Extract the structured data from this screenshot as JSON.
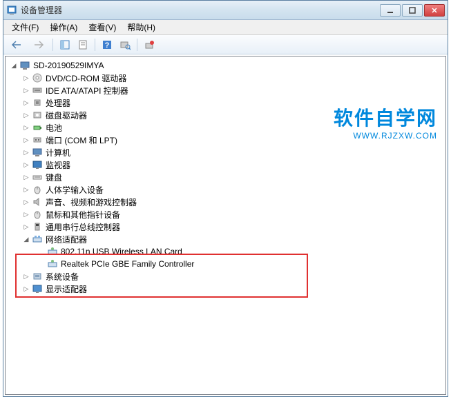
{
  "window": {
    "title": "设备管理器"
  },
  "menu": {
    "file": "文件(F)",
    "action": "操作(A)",
    "view": "查看(V)",
    "help": "帮助(H)"
  },
  "tree": {
    "root": "SD-20190529IMYA",
    "items": [
      {
        "label": "DVD/CD-ROM 驱动器",
        "icon": "disc"
      },
      {
        "label": "IDE ATA/ATAPI 控制器",
        "icon": "ide"
      },
      {
        "label": "处理器",
        "icon": "cpu"
      },
      {
        "label": "磁盘驱动器",
        "icon": "disk"
      },
      {
        "label": "电池",
        "icon": "battery"
      },
      {
        "label": "端口 (COM 和 LPT)",
        "icon": "port"
      },
      {
        "label": "计算机",
        "icon": "computer"
      },
      {
        "label": "监视器",
        "icon": "monitor"
      },
      {
        "label": "键盘",
        "icon": "keyboard"
      },
      {
        "label": "人体学输入设备",
        "icon": "hid"
      },
      {
        "label": "声音、视频和游戏控制器",
        "icon": "sound"
      },
      {
        "label": "鼠标和其他指针设备",
        "icon": "mouse"
      },
      {
        "label": "通用串行总线控制器",
        "icon": "usb"
      }
    ],
    "network": {
      "label": "网络适配器",
      "children": [
        "802.11n USB Wireless LAN Card",
        "Realtek PCIe GBE Family Controller"
      ]
    },
    "after": [
      {
        "label": "系统设备",
        "icon": "system"
      },
      {
        "label": "显示适配器",
        "icon": "display"
      }
    ]
  },
  "watermark": {
    "main": "软件自学网",
    "sub": "WWW.RJZXW.COM"
  }
}
